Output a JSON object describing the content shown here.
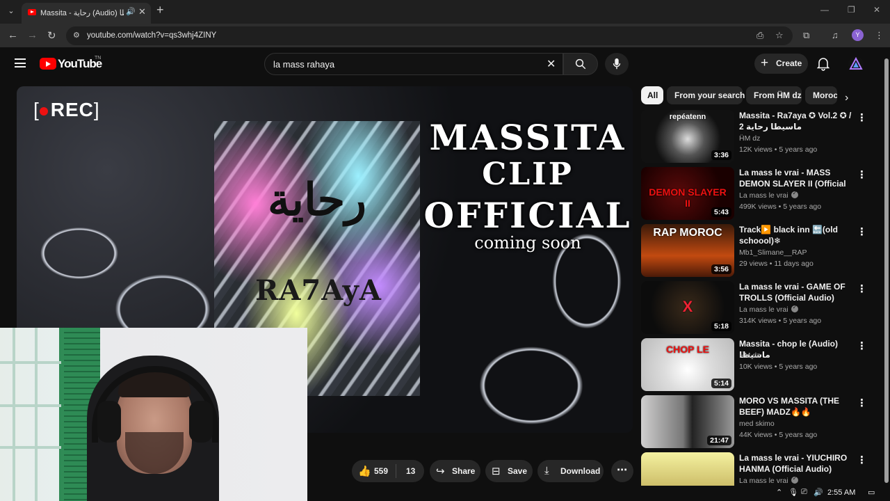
{
  "browser": {
    "tab_title": "Massita - رحاية (Audio) ماسيطا",
    "url": "youtube.com/watch?v=qs3whj4ZINY",
    "profile_initial": "Y"
  },
  "youtube": {
    "logo_text": "YouTube",
    "country_code": "TN",
    "search_query": "la mass rahaya",
    "create_label": "Create"
  },
  "video": {
    "overlay_rec": "REC",
    "cover_arabic": "رحاية",
    "cover_latin": "RA7AyA",
    "promo_line1": "MASSITA",
    "promo_line2": "CLIP",
    "promo_line3": "OFFICIAL",
    "promo_line4": "coming soon"
  },
  "actions": {
    "likes": "559",
    "dislikes": "13",
    "share_label": "Share",
    "save_label": "Save",
    "download_label": "Download"
  },
  "chips": [
    "All",
    "From your search",
    "From ḦM dz",
    "Moroc"
  ],
  "recommendations": [
    {
      "title": "Massita - Ra7aya ✪ Vol.2 ✪ / ماسيطا رحاية 2",
      "channel": "ḦM dz",
      "views": "12K views",
      "age": "5 years ago",
      "duration": "3:36",
      "verified": false
    },
    {
      "title": "La mass le vrai - MASS DEMON SLAYER II (Official Audio by ...",
      "channel": "La mass le vrai",
      "views": "499K views",
      "age": "5 years ago",
      "duration": "5:43",
      "verified": true
    },
    {
      "title": "Track▶️ black inn 🔙(old schoool)❄",
      "channel": "Mb1_Slimane__RAP",
      "views": "29 views",
      "age": "11 days ago",
      "duration": "3:56",
      "verified": false
    },
    {
      "title": "La mass le vrai - GAME OF TROLLS (Official Audio)",
      "channel": "La mass le vrai",
      "views": "314K views",
      "age": "5 years ago",
      "duration": "5:18",
      "verified": true
    },
    {
      "title": "Massita - chop le (Audio) ماسيطا",
      "channel": "ḦM dz",
      "views": "10K views",
      "age": "5 years ago",
      "duration": "5:14",
      "verified": false
    },
    {
      "title": "MORO VS MASSITA (THE BEEF) MADZ🔥🔥",
      "channel": "med skimo",
      "views": "44K views",
      "age": "5 years ago",
      "duration": "21:47",
      "verified": false
    },
    {
      "title": "La mass le vrai - YIUCHIRO HANMA (Official Audio)",
      "channel": "La mass le vrai",
      "views": "",
      "age": "",
      "duration": "",
      "verified": true
    }
  ],
  "thumb_labels": [
    "repéatenn",
    "DEMON SLAYER II",
    "RAP MOROC",
    "X",
    "CHOP LE",
    "",
    ""
  ],
  "taskbar": {
    "time": "2:55 AM"
  },
  "colors": {
    "accent": "#ff0000",
    "background": "#0f0f0f",
    "chip_bg": "#272727"
  }
}
